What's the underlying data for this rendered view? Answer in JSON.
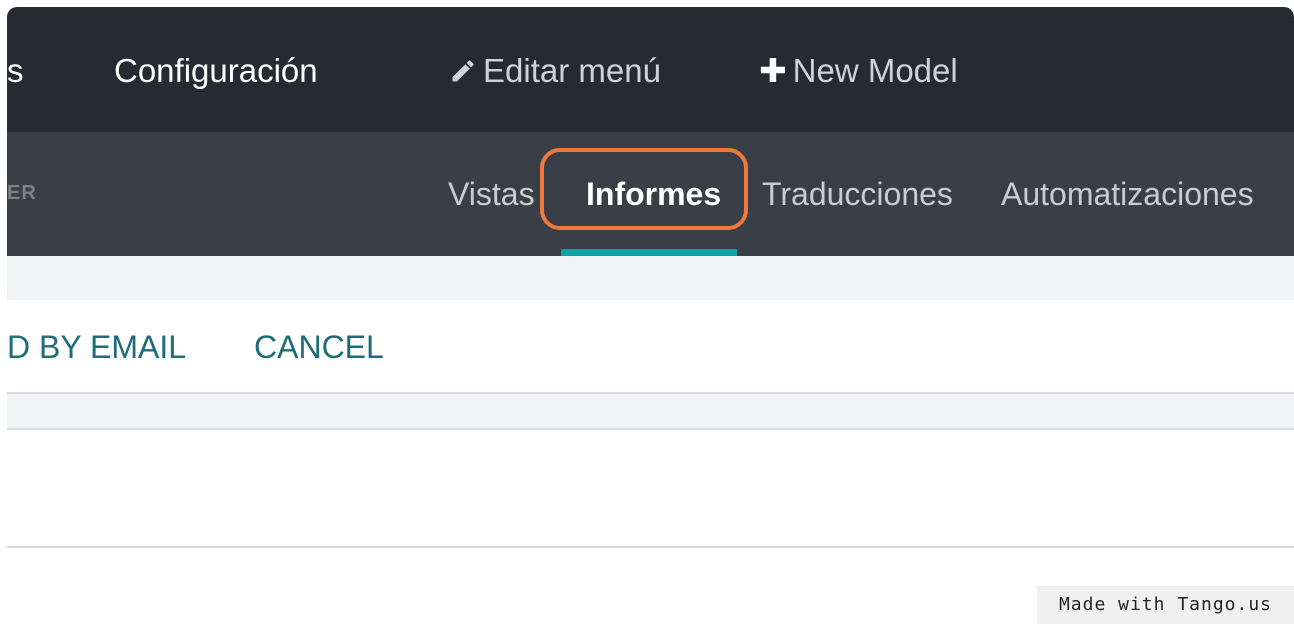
{
  "topnav": {
    "cut_item": "s",
    "configuracion": "Configuración",
    "edit_menu": "Editar menú",
    "new_model": "New Model"
  },
  "subnav": {
    "cut_label": "ER",
    "tabs": [
      {
        "label": "Vistas"
      },
      {
        "label": "Informes",
        "active": true
      },
      {
        "label": "Traducciones"
      },
      {
        "label": "Automatizaciones"
      }
    ]
  },
  "actions": {
    "send_by_email": "D BY EMAIL",
    "cancel": "CANCEL"
  },
  "watermark": "Made with Tango.us",
  "colors": {
    "topbar": "#262a33",
    "subbar": "#3a3f47",
    "accent": "#12a2a4",
    "highlight": "#f07a3a",
    "action_text": "#1d6c78"
  },
  "icons": [
    "pencil-icon",
    "plus-icon"
  ]
}
